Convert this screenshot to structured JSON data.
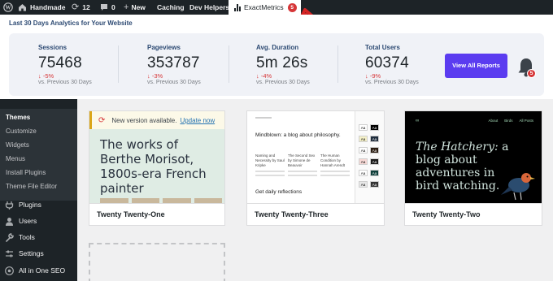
{
  "adminbar": {
    "site_name": "Handmade",
    "updates_count": "12",
    "comments_count": "0",
    "new_label": "New",
    "caching_label": "Caching",
    "dev_helpers_label": "Dev Helpers",
    "exactmetrics_label": "ExactMetrics",
    "exactmetrics_badge": "5"
  },
  "analytics": {
    "title": "Last 30 Days Analytics for Your Website",
    "stats": [
      {
        "label": "Sessions",
        "value": "75468",
        "change": "-5%",
        "previous": "vs. Previous 30 Days"
      },
      {
        "label": "Pageviews",
        "value": "353787",
        "change": "-3%",
        "previous": "vs. Previous 30 Days"
      },
      {
        "label": "Avg. Duration",
        "value": "5m 26s",
        "change": "-4%",
        "previous": "vs. Previous 30 Days"
      },
      {
        "label": "Total Users",
        "value": "60374",
        "change": "-9%",
        "previous": "vs. Previous 30 Days"
      }
    ],
    "view_all_label": "View All Reports",
    "notification_count": "5"
  },
  "sidebar": {
    "submenu": [
      "Themes",
      "Customize",
      "Widgets",
      "Menus",
      "Install Plugins",
      "Theme File Editor"
    ],
    "menu": [
      "Plugins",
      "Users",
      "Tools",
      "Settings",
      "All in One SEO"
    ]
  },
  "themes": [
    {
      "name": "Twenty Twenty-One",
      "notice_text": "New version available.",
      "notice_link": "Update now",
      "headline": "The works of Berthe Morisot, 1800s-era French painter"
    },
    {
      "name": "Twenty Twenty-Three",
      "headline": "Mindblown: a blog about philosophy.",
      "columns": [
        "Naming and Necessity by Saul Kripke",
        "The Second Sex by Simone de Beauvoir",
        "The Human Condition by Hannah Arendt"
      ],
      "cta": "Get daily reflections"
    },
    {
      "name": "Twenty Twenty-Two",
      "headline_em": "The Hatchery:",
      "headline_rest": " a blog about adventures in bird watching.",
      "nav": [
        "About",
        "Birds",
        "All Posts"
      ]
    }
  ],
  "colors": {
    "admin_bar": "#1d2327",
    "accent_purple": "#5b3cf0",
    "negative": "#d63638",
    "link": "#2271b1"
  }
}
